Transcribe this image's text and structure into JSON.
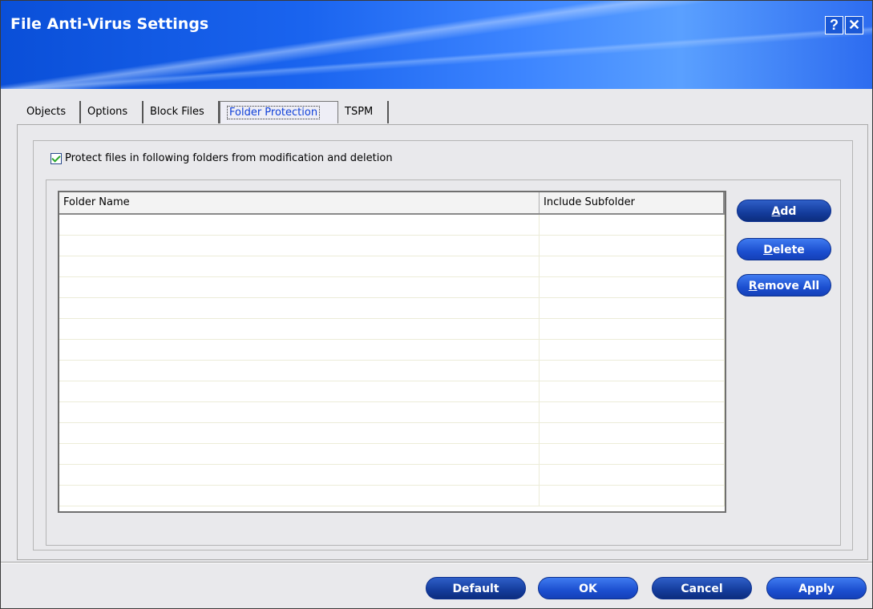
{
  "window": {
    "title": "File Anti-Virus Settings",
    "help_glyph": "?",
    "close_glyph": "✕"
  },
  "tabs": [
    {
      "label": "Objects",
      "active": false
    },
    {
      "label": "Options",
      "active": false
    },
    {
      "label": "Block Files",
      "active": false
    },
    {
      "label": "Folder Protection",
      "active": true
    },
    {
      "label": "TSPM",
      "active": false
    }
  ],
  "folder_protection": {
    "checkbox_label": "Protect files in following folders from modification and deletion",
    "checkbox_checked": true,
    "table": {
      "columns": [
        "Folder Name",
        "Include Subfolder"
      ],
      "rows": []
    },
    "buttons": {
      "add": {
        "mnemonic": "A",
        "rest": "dd"
      },
      "delete": {
        "mnemonic": "D",
        "rest": "elete"
      },
      "remove_all": {
        "mnemonic": "R",
        "rest": "emove All"
      }
    }
  },
  "footer": {
    "default": "Default",
    "ok": "OK",
    "cancel": "Cancel",
    "apply": "Apply"
  },
  "colors": {
    "accent": "#1c4fd0",
    "title_bar": "#1a64ef",
    "active_tab_text": "#1040d8"
  }
}
